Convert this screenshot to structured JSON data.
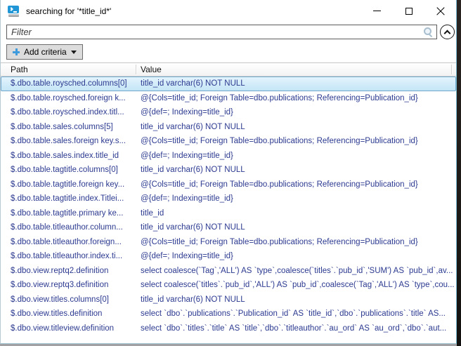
{
  "window": {
    "title": "searching for '*title_id*'",
    "app_icon": "powershell-icon",
    "controls": {
      "minimize": "minimize-icon",
      "maximize": "maximize-icon",
      "close": "close-icon"
    }
  },
  "filter": {
    "placeholder": "Filter",
    "search_icon": "search-icon",
    "collapse_icon": "chevron-up-circle-icon"
  },
  "toolbar": {
    "add_criteria_label": "Add criteria",
    "plus_icon": "plus-icon",
    "dropdown_icon": "chevron-down-icon"
  },
  "table": {
    "columns": [
      "Path",
      "Value"
    ],
    "selected_row_index": 0,
    "rows": [
      {
        "path": "$.dbo.table.roysched.columns[0]",
        "value": "title_id varchar(6) NOT NULL"
      },
      {
        "path": "$.dbo.table.roysched.foreign k...",
        "value": "@{Cols=title_id; Foreign Table=dbo.publications; Referencing=Publication_id}"
      },
      {
        "path": "$.dbo.table.roysched.index.titl...",
        "value": "@{def=; Indexing=title_id}"
      },
      {
        "path": "$.dbo.table.sales.columns[5]",
        "value": "title_id varchar(6) NOT NULL"
      },
      {
        "path": "$.dbo.table.sales.foreign key.s...",
        "value": "@{Cols=title_id; Foreign Table=dbo.publications; Referencing=Publication_id}"
      },
      {
        "path": "$.dbo.table.sales.index.title_id",
        "value": "@{def=; Indexing=title_id}"
      },
      {
        "path": "$.dbo.table.tagtitle.columns[0]",
        "value": "title_id varchar(6) NOT NULL"
      },
      {
        "path": "$.dbo.table.tagtitle.foreign key...",
        "value": "@{Cols=title_id; Foreign Table=dbo.publications; Referencing=Publication_id}"
      },
      {
        "path": "$.dbo.table.tagtitle.index.Titlei...",
        "value": "@{def=; Indexing=title_id}"
      },
      {
        "path": "$.dbo.table.tagtitle.primary ke...",
        "value": "title_id"
      },
      {
        "path": "$.dbo.table.titleauthor.column...",
        "value": "title_id varchar(6) NOT NULL"
      },
      {
        "path": "$.dbo.table.titleauthor.foreign...",
        "value": "@{Cols=title_id; Foreign Table=dbo.publications; Referencing=Publication_id}"
      },
      {
        "path": "$.dbo.table.titleauthor.index.ti...",
        "value": "@{def=; Indexing=title_id}"
      },
      {
        "path": "$.dbo.view.reptq2.definition",
        "value": "select coalesce(`Tag`,'ALL') AS `type`,coalesce(`titles`.`pub_id`,'SUM') AS `pub_id`,av..."
      },
      {
        "path": "$.dbo.view.reptq3.definition",
        "value": "select coalesce(`titles`.`pub_id`,'ALL') AS `pub_id`,coalesce(`Tag`,'ALL') AS `type`,cou..."
      },
      {
        "path": "$.dbo.view.titles.columns[0]",
        "value": "title_id varchar(6) NOT NULL"
      },
      {
        "path": "$.dbo.view.titles.definition",
        "value": "select `dbo`.`publications`.`Publication_id` AS `title_id`,`dbo`.`publications`.`title` AS..."
      },
      {
        "path": "$.dbo.view.titleview.definition",
        "value": "select `dbo`.`titles`.`title` AS `title`,`dbo`.`titleauthor`.`au_ord` AS `au_ord`,`dbo`.`aut..."
      }
    ]
  },
  "colors": {
    "row_text": "#2c3a90",
    "selection_border": "#70a7cc",
    "selection_fill_top": "#e3f4fd",
    "selection_fill_bottom": "#c4e5f6",
    "window_border": "#79bdd3",
    "plus_blue": "#3f9bdc"
  }
}
